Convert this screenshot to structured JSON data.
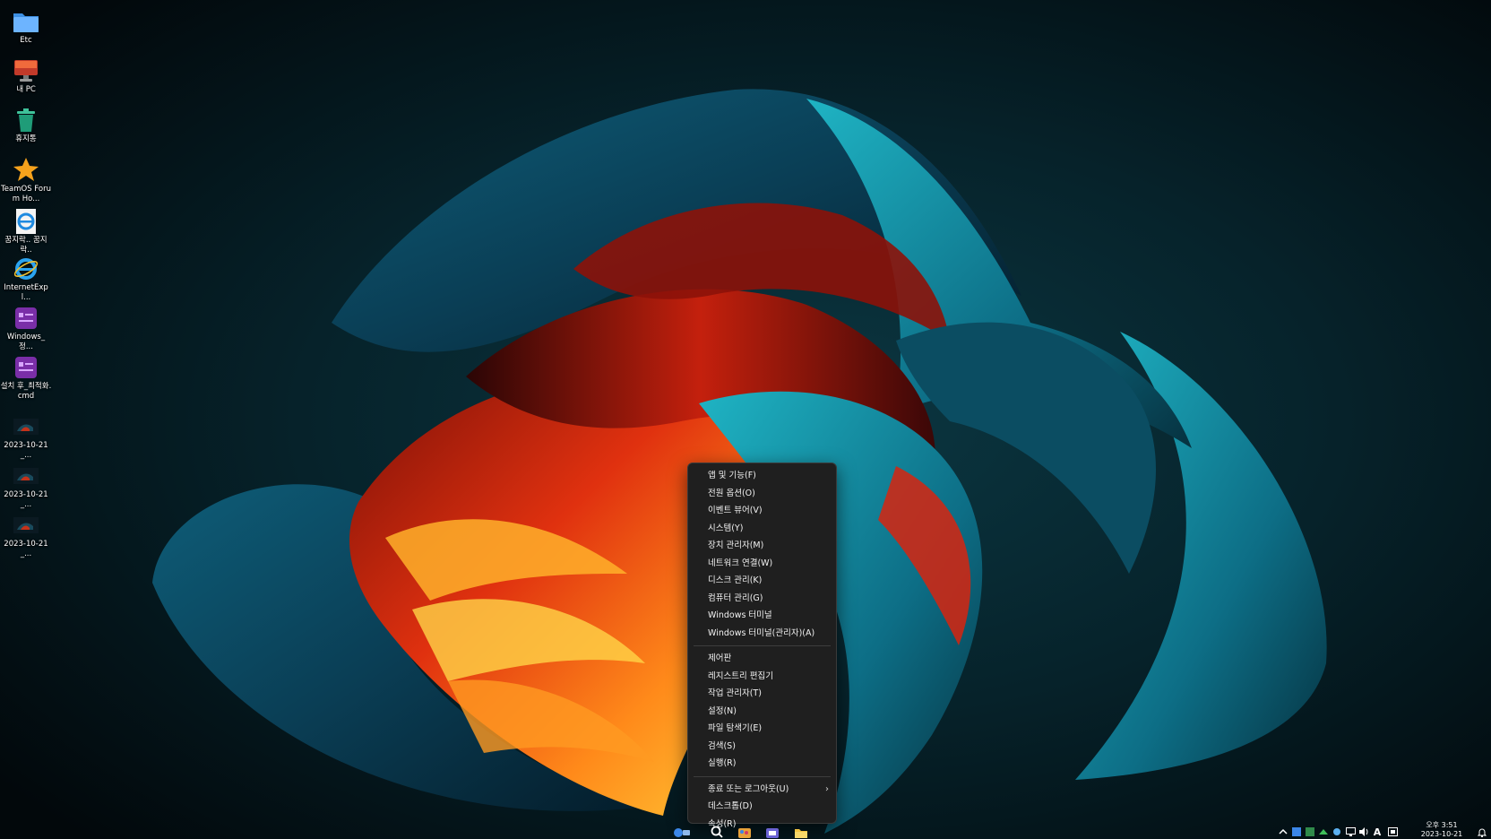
{
  "desktop": {
    "icons": [
      {
        "name": "Etc",
        "icon": "folder-icon"
      },
      {
        "name": "내 PC",
        "icon": "monitor-icon"
      },
      {
        "name": "휴지통",
        "icon": "recycle-bin-icon"
      },
      {
        "name": "TeamOS Forum Ho...",
        "icon": "star-icon"
      },
      {
        "name": "꿈지락.. 꿈지락..",
        "icon": "ie-shortcut-icon"
      },
      {
        "name": "InternetExpl...",
        "icon": "internet-explorer-icon"
      },
      {
        "name": "Windows_정...",
        "icon": "script-icon"
      },
      {
        "name": "설치 후_최적화.cmd",
        "icon": "script-icon"
      },
      {
        "name": "2023-10-21_...",
        "icon": "screenshot-thumbnail-icon"
      },
      {
        "name": "2023-10-21_...",
        "icon": "screenshot-thumbnail-icon"
      },
      {
        "name": "2023-10-21_...",
        "icon": "screenshot-thumbnail-icon"
      }
    ]
  },
  "context_menu": {
    "group1": [
      "앱 및 기능(F)",
      "전원 옵션(O)",
      "이벤트 뷰어(V)",
      "시스템(Y)",
      "장치 관리자(M)",
      "네트워크 연결(W)",
      "디스크 관리(K)",
      "컴퓨터 관리(G)",
      "Windows 터미널",
      "Windows 터미널(관리자)(A)"
    ],
    "group2": [
      "제어판",
      "레지스트리 편집기",
      "작업 관리자(T)",
      "설정(N)",
      "파일 탐색기(E)",
      "검색(S)",
      "실행(R)"
    ],
    "group3": [
      {
        "label": "종료 또는 로그아웃(U)",
        "has_submenu": true
      },
      {
        "label": "데스크톱(D)",
        "has_submenu": false
      },
      {
        "label": "속성(R)",
        "has_submenu": false
      }
    ]
  },
  "taskbar": {
    "apps": [
      "start-icon",
      "search-icon",
      "paint-icon",
      "teams-icon",
      "file-explorer-icon"
    ],
    "tray": {
      "ime": "A",
      "clock_line1": "오후 3:51",
      "clock_line2": "2023-10-21"
    }
  },
  "colors": {
    "menu_bg": "#1f1f1f",
    "accent": "#0067c0"
  }
}
